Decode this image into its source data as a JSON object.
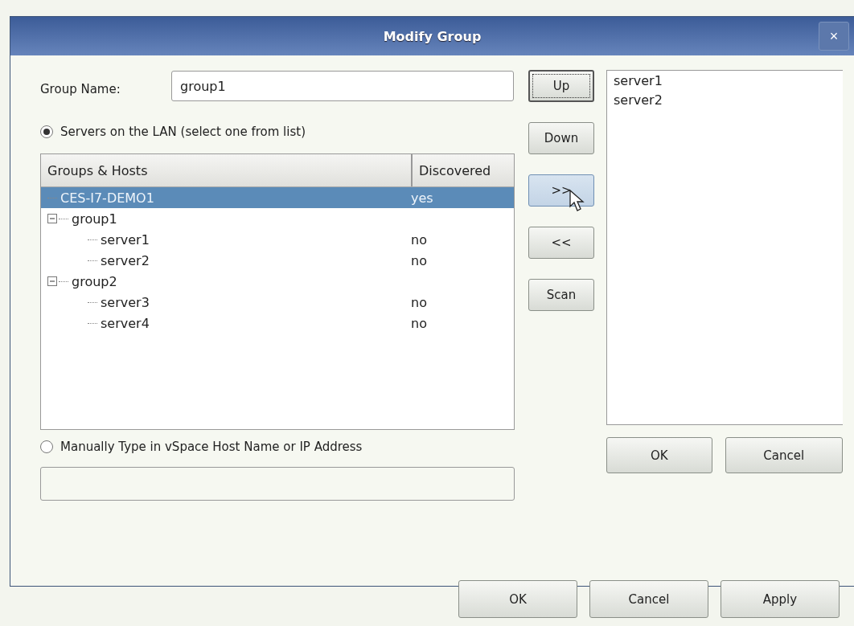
{
  "window": {
    "title": "Modify Group",
    "close": "×"
  },
  "group_name": {
    "label": "Group Name:",
    "value": "group1"
  },
  "source_options": [
    {
      "label": "Servers on the LAN (select one from list)",
      "selected": true
    },
    {
      "label": "Manually Type in vSpace Host Name or IP Address",
      "selected": false
    }
  ],
  "tree": {
    "columns": [
      "Groups & Hosts",
      "Discovered"
    ],
    "items": [
      {
        "name": "CES-I7-DEMO1",
        "discovered": "yes",
        "selected": true
      },
      {
        "name": "group1",
        "expanded": true,
        "selected": false,
        "children": [
          {
            "name": "server1",
            "discovered": "no",
            "selected": false
          },
          {
            "name": "server2",
            "discovered": "no",
            "selected": false
          }
        ]
      },
      {
        "name": "group2",
        "expanded": true,
        "selected": false,
        "children": [
          {
            "name": "server3",
            "discovered": "no",
            "selected": false
          },
          {
            "name": "server4",
            "discovered": "no",
            "selected": false
          }
        ]
      }
    ]
  },
  "side_buttons": [
    {
      "label": "Up",
      "focused": true,
      "hovered": false
    },
    {
      "label": "Down",
      "focused": false,
      "hovered": false
    },
    {
      "label": ">>",
      "focused": false,
      "hovered": true
    },
    {
      "label": "<<",
      "focused": false,
      "hovered": false
    },
    {
      "label": "Scan",
      "focused": false,
      "hovered": false
    }
  ],
  "selected_servers": [
    "server1",
    "server2"
  ],
  "dialog_buttons": [
    "OK",
    "Cancel"
  ],
  "background_buttons": [
    "OK",
    "Cancel",
    "Apply"
  ]
}
